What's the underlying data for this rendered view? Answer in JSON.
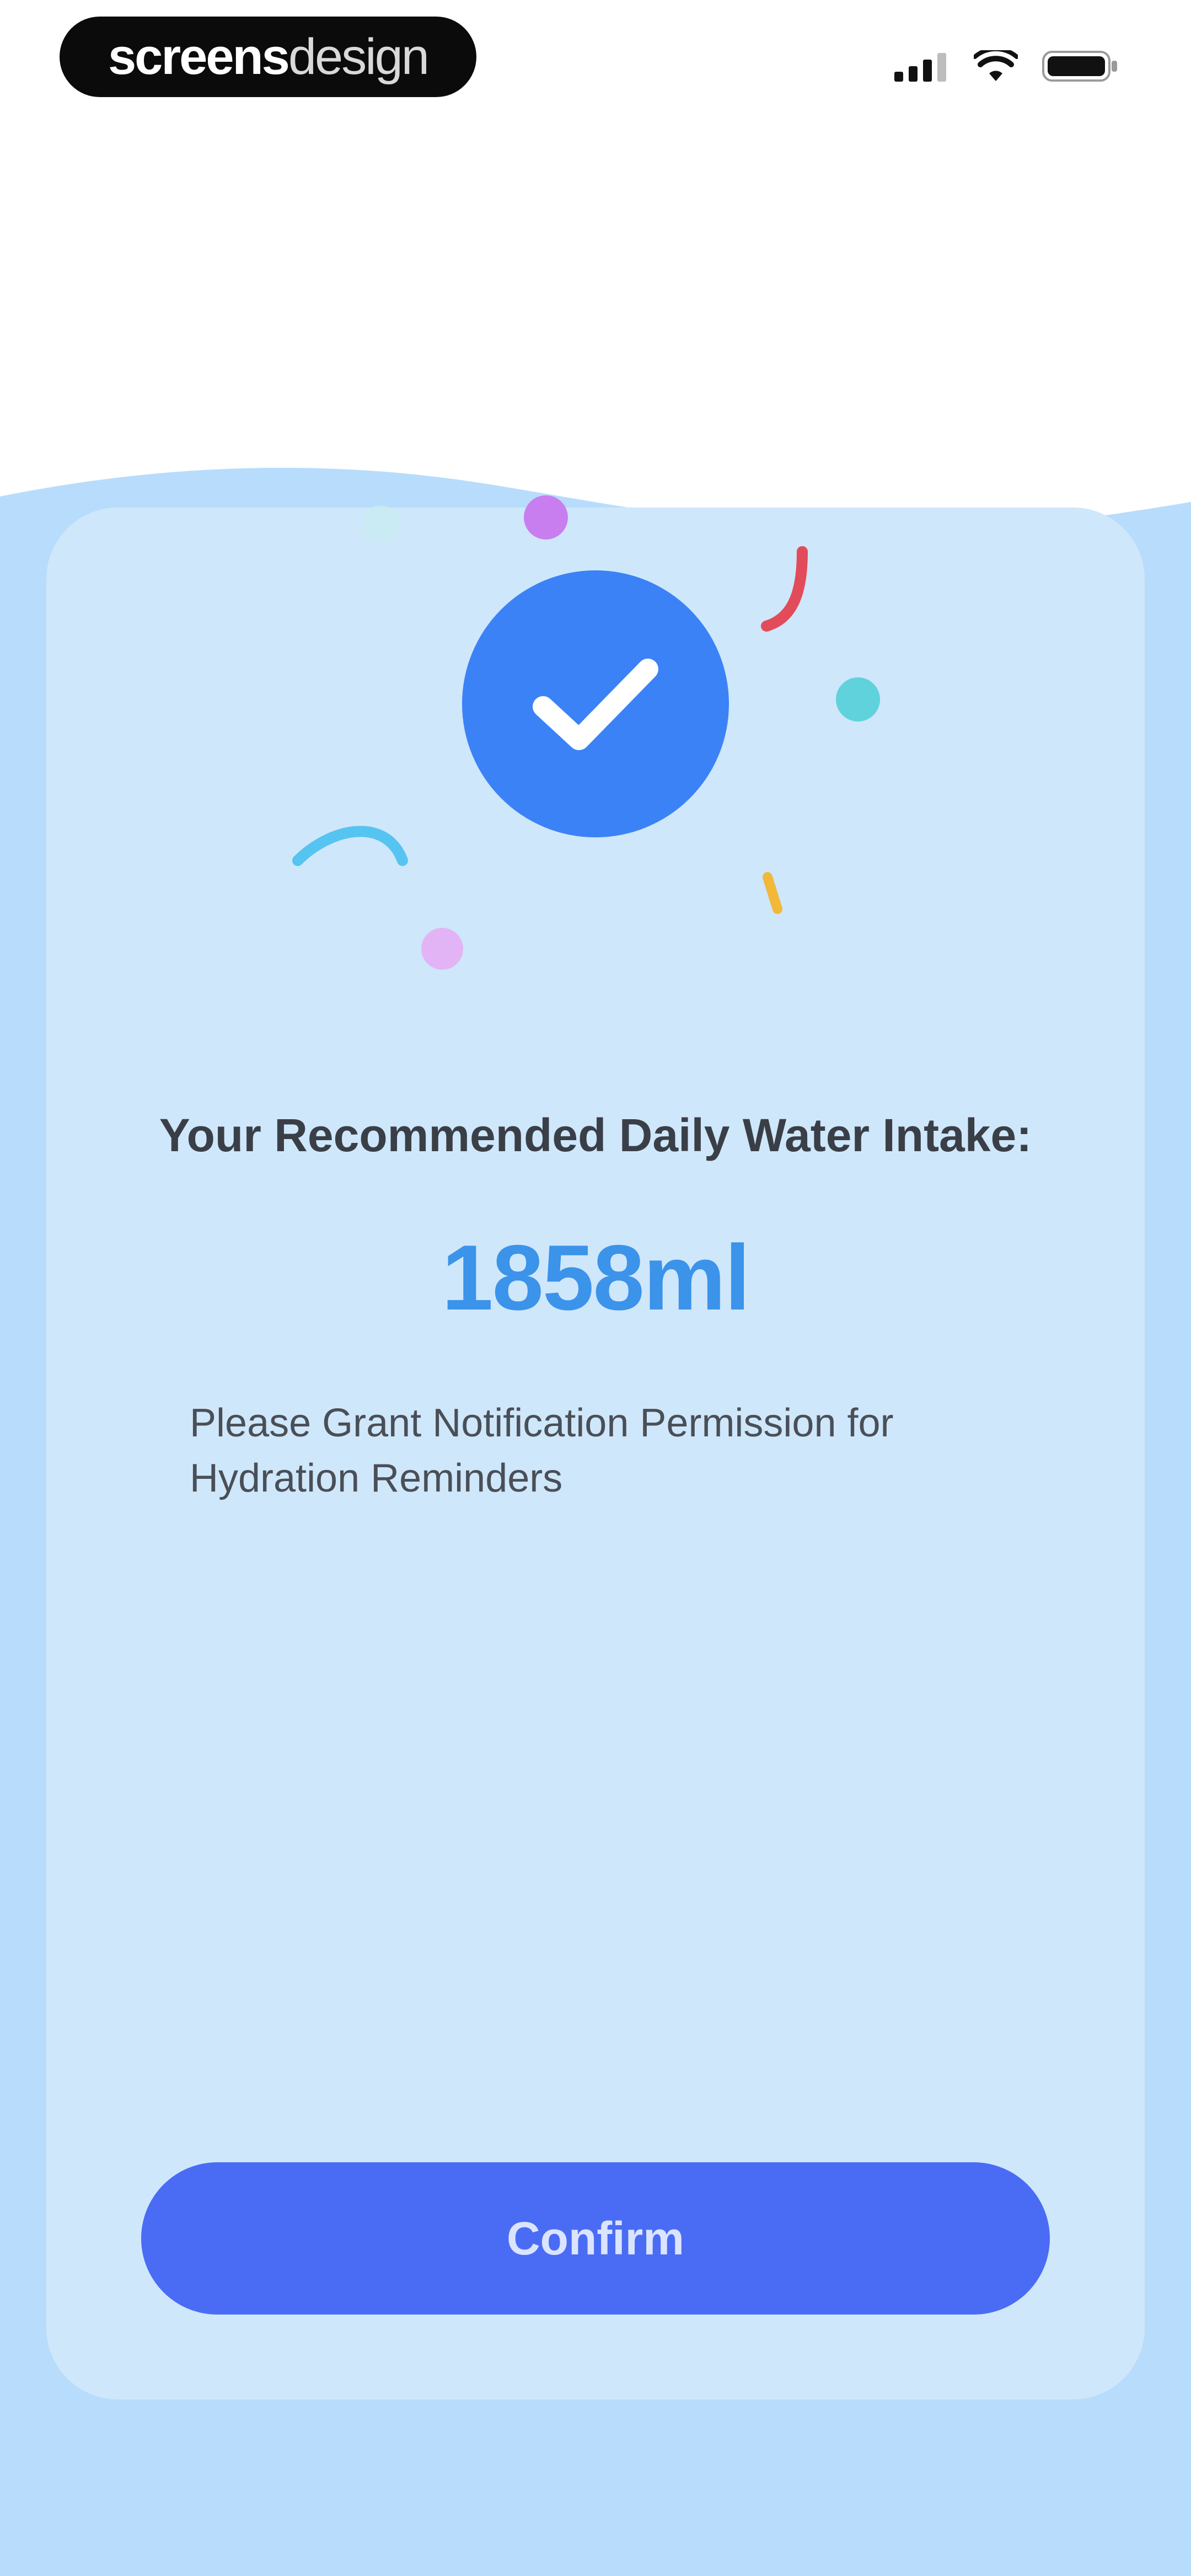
{
  "status_bar": {
    "brand_part1": "screens",
    "brand_part2": "design",
    "icons": [
      "cellular-signal-icon",
      "wifi-icon",
      "battery-icon"
    ]
  },
  "result": {
    "headline": "Your Recommended Daily Water Intake:",
    "amount": "1858ml",
    "permission_note": "Please Grant Notification Permission for Hydration Reminders"
  },
  "actions": {
    "confirm_label": "Confirm"
  },
  "colors": {
    "accent_blue": "#3b82f6",
    "amount_blue": "#3b93ea",
    "button_blue": "#4a6cf4",
    "water_light": "#cfe7fb",
    "water_outer": "#b8dcfb"
  }
}
